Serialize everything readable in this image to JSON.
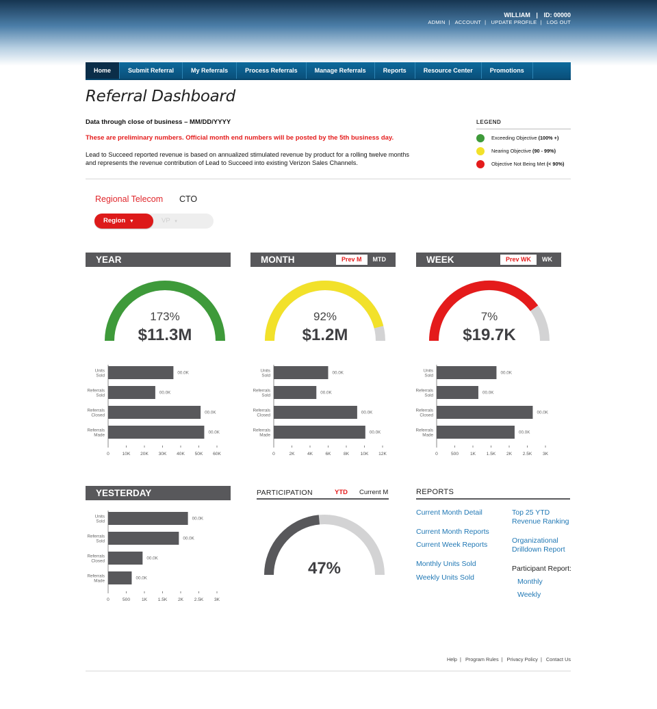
{
  "user": {
    "name": "WILLIAM",
    "id_label": "ID: 00000",
    "links": [
      "ADMIN",
      "ACCOUNT",
      "UPDATE PROFILE",
      "LOG OUT"
    ]
  },
  "nav": [
    "Home",
    "Submit Referral",
    "My Referrals",
    "Process Referrals",
    "Manage Referrals",
    "Reports",
    "Resource Center",
    "Promotions"
  ],
  "page": {
    "title": "Referral Dashboard",
    "data_through": "Data through close of business – MM/DD/YYYY",
    "preliminary": "These are preliminary numbers. Official month end numbers will be posted by the 5th business day.",
    "description": "Lead to Succeed reported revenue is based on annualized stimulated revenue by product for a rolling twelve months and represents the revenue contribution of Lead to Succeed into existing Verizon Sales Channels."
  },
  "legend": {
    "title": "LEGEND",
    "items": [
      {
        "label": "Exceeding Objective",
        "range": "(100% +)",
        "color": "#3e9a3a"
      },
      {
        "label": "Nearing Objective",
        "range": "(90 - 99%)",
        "color": "#f2e12a"
      },
      {
        "label": "Objective Not Being Met",
        "range": "(< 90%)",
        "color": "#e41b1b"
      }
    ]
  },
  "filters": {
    "org_link": "Regional Telecom",
    "org_label": "CTO",
    "region_button": "Region",
    "vp_button": "VP"
  },
  "colors": {
    "green": "#3e9a3a",
    "yellow": "#f2e12a",
    "red": "#e41b1b",
    "track": "#d3d3d4",
    "bar": "#58585b",
    "link": "#1f77b4"
  },
  "panels": {
    "year": {
      "header": "YEAR",
      "percent": "173%",
      "value": "$11.3M"
    },
    "month": {
      "header": "MONTH",
      "tabs": [
        "Prev M",
        "MTD"
      ],
      "percent": "92%",
      "value": "$1.2M"
    },
    "week": {
      "header": "WEEK",
      "tabs": [
        "Prev WK",
        "WK"
      ],
      "percent": "7%",
      "value": "$19.7K"
    },
    "yesterday": {
      "header": "YESTERDAY"
    }
  },
  "participation": {
    "header": "PARTICIPATION",
    "tabs": [
      "YTD",
      "Current M"
    ],
    "percent": "47%"
  },
  "reports": {
    "header": "REPORTS",
    "col1": [
      "Current Month Detail",
      "Current Month Reports",
      "Current Week Reports",
      "Monthly Units Sold",
      "Weekly Units Sold"
    ],
    "col2": [
      "Top 25 YTD Revenue Ranking",
      "Organizational Drilldown Report"
    ],
    "participant_label": "Participant Report:",
    "participant_links": [
      "Monthly",
      "Weekly"
    ]
  },
  "footer": [
    "Help",
    "Program Rules",
    "Privacy Policy",
    "Contact Us"
  ],
  "chart_data": [
    {
      "type": "gauge",
      "name": "YEAR",
      "percent": 173,
      "value_label": "$11.3M",
      "fill_fraction": 1.0,
      "color": "#3e9a3a"
    },
    {
      "type": "gauge",
      "name": "MONTH",
      "percent": 92,
      "value_label": "$1.2M",
      "fill_fraction": 0.92,
      "color": "#f2e12a"
    },
    {
      "type": "gauge",
      "name": "WEEK",
      "percent": 7,
      "value_label": "$19.7K",
      "fill_fraction": 0.8,
      "color": "#e41b1b"
    },
    {
      "type": "bar",
      "orientation": "horizontal",
      "panel": "year",
      "categories": [
        "Units Sold",
        "Referrals Sold",
        "Referrals Closed",
        "Referrals Made"
      ],
      "values": [
        36000,
        26000,
        51000,
        53000
      ],
      "data_labels": [
        "00.0K",
        "00.0K",
        "00.0K",
        "00.0K"
      ],
      "xlim": [
        0,
        60000
      ],
      "ticks": [
        "0",
        "10K",
        "20K",
        "30K",
        "40K",
        "50K",
        "60K"
      ]
    },
    {
      "type": "bar",
      "orientation": "horizontal",
      "panel": "month",
      "categories": [
        "Units Sold",
        "Referrals Sold",
        "Referrals Closed",
        "Referrals Made"
      ],
      "values": [
        6000,
        4700,
        9200,
        10100
      ],
      "data_labels": [
        "00.0K",
        "00.0K",
        "00.0K",
        "00.0K"
      ],
      "xlim": [
        0,
        12000
      ],
      "ticks": [
        "0",
        "2K",
        "4K",
        "6K",
        "8K",
        "10K",
        "12K"
      ]
    },
    {
      "type": "bar",
      "orientation": "horizontal",
      "panel": "week",
      "categories": [
        "Units Sold",
        "Referrals Sold",
        "Referrals Closed",
        "Referrals Made"
      ],
      "values": [
        1650,
        1150,
        2650,
        2150
      ],
      "data_labels": [
        "00.0K",
        "00.0K",
        "00.0K",
        "00.0K"
      ],
      "xlim": [
        0,
        3000
      ],
      "ticks": [
        "0",
        "500",
        "1K",
        "1.5K",
        "2K",
        "2.5K",
        "3K"
      ]
    },
    {
      "type": "bar",
      "orientation": "horizontal",
      "panel": "yesterday",
      "categories": [
        "Units Sold",
        "Referrals Sold",
        "Referrals Closed",
        "Referrals Made"
      ],
      "values": [
        2200,
        1950,
        950,
        650
      ],
      "data_labels": [
        "00.0K",
        "00.0K",
        "00.0K",
        "00.0K"
      ],
      "xlim": [
        0,
        3000
      ],
      "ticks": [
        "0",
        "500",
        "1K",
        "1.5K",
        "2K",
        "2.5K",
        "3K"
      ]
    },
    {
      "type": "gauge",
      "name": "PARTICIPATION",
      "percent": 47,
      "fill_fraction": 0.47,
      "color": "#58585b"
    }
  ]
}
